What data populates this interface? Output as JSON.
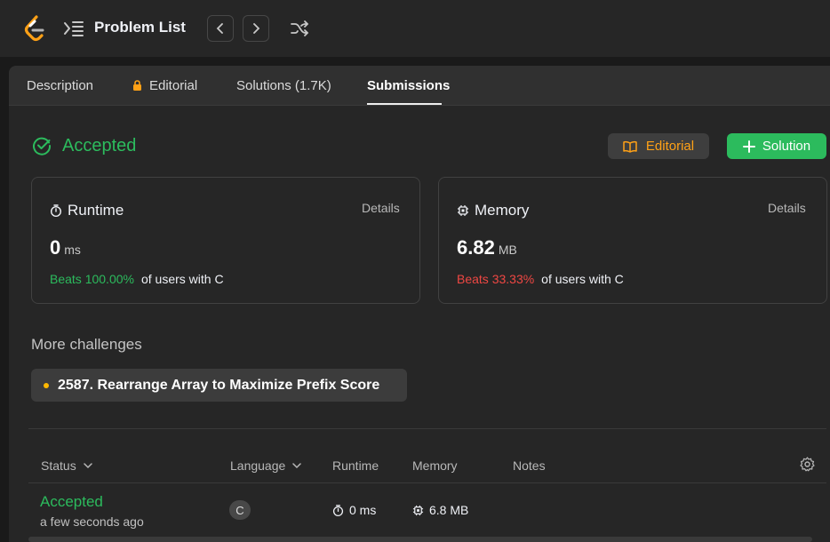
{
  "topbar": {
    "title": "Problem List",
    "icons": [
      "leetcode-logo",
      "problem-list-icon",
      "chevron-left-icon",
      "chevron-right-icon",
      "shuffle-icon"
    ]
  },
  "tabs": [
    {
      "label": "Description",
      "active": false
    },
    {
      "label": "Editorial",
      "active": false,
      "icon": "lock-icon"
    },
    {
      "label": "Solutions (1.7K)",
      "active": false
    },
    {
      "label": "Submissions",
      "active": true
    }
  ],
  "result": {
    "status": "Accepted",
    "editorial_button": "Editorial",
    "solution_button": "Solution"
  },
  "runtime": {
    "title": "Runtime",
    "details": "Details",
    "value": "0",
    "unit": "ms",
    "beats": "Beats 100.00%",
    "suffix": "of users with C"
  },
  "memory": {
    "title": "Memory",
    "details": "Details",
    "value": "6.82",
    "unit": "MB",
    "beats": "Beats 33.33%",
    "suffix": "of users with C"
  },
  "more_challenges": {
    "title": "More challenges",
    "items": [
      "2587. Rearrange Array to Maximize Prefix Score"
    ]
  },
  "table": {
    "headers": {
      "status": "Status",
      "language": "Language",
      "runtime": "Runtime",
      "memory": "Memory",
      "notes": "Notes"
    },
    "rows": [
      {
        "status": "Accepted",
        "time": "a few seconds ago",
        "language": "C",
        "runtime": "0 ms",
        "memory": "6.8 MB"
      }
    ]
  },
  "colors": {
    "accepted": "#2cbb5d",
    "editorial": "#ffa116",
    "beats_low": "#ef4743",
    "challenge_dot": "#ffb800"
  }
}
